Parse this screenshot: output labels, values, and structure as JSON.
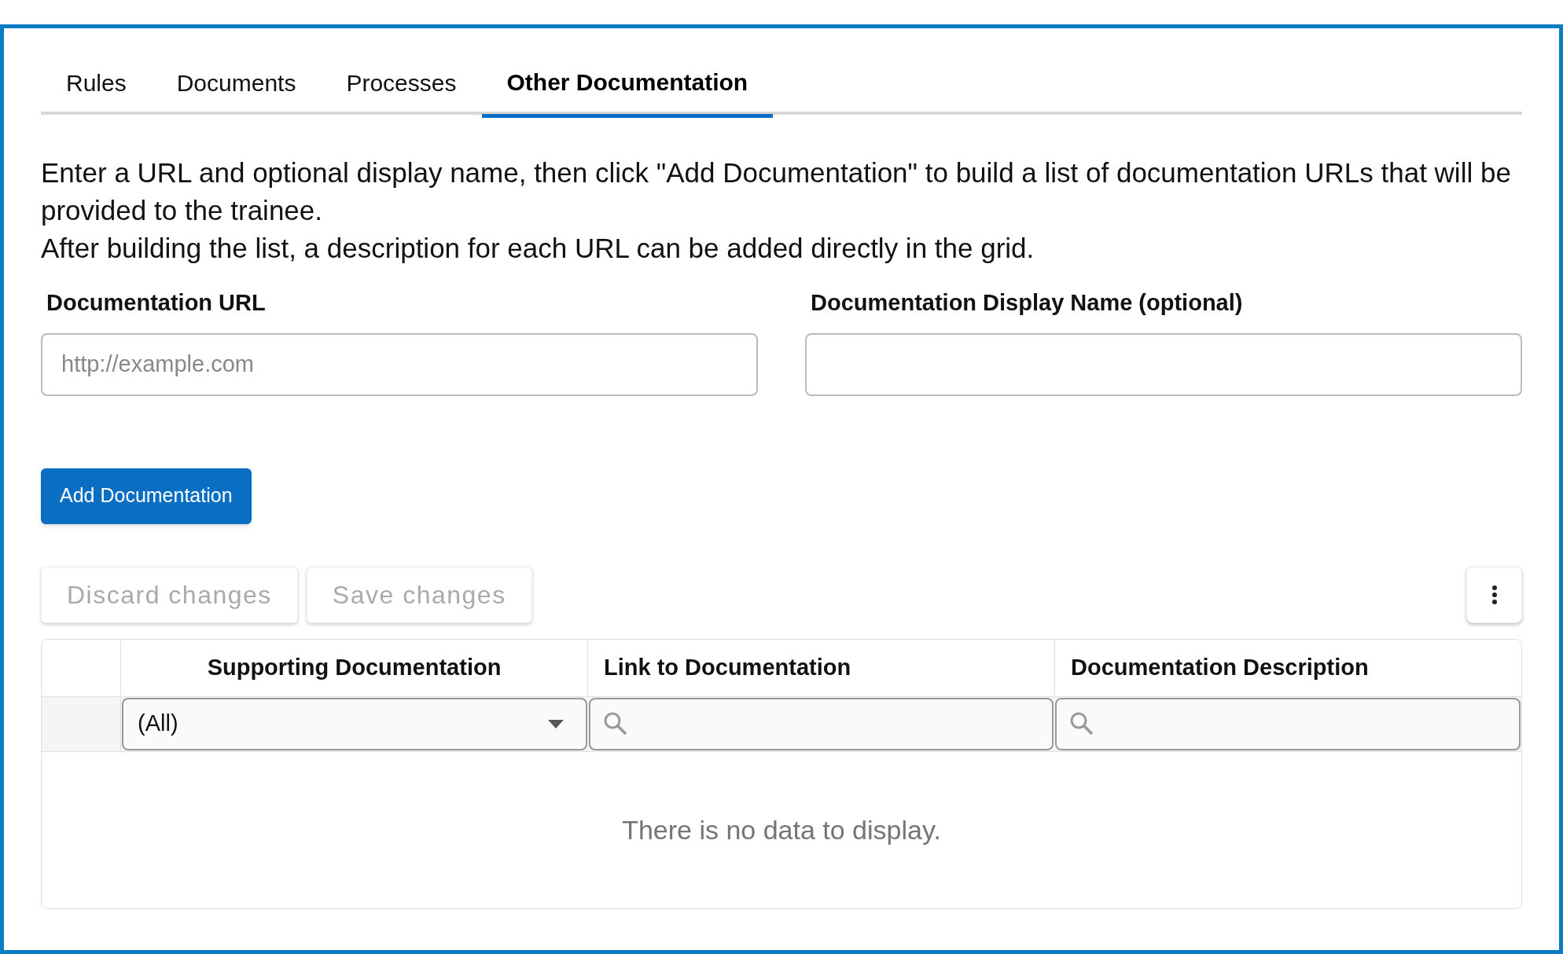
{
  "tabs": [
    {
      "label": "Rules",
      "selected": false
    },
    {
      "label": "Documents",
      "selected": false
    },
    {
      "label": "Processes",
      "selected": false
    },
    {
      "label": "Other Documentation",
      "selected": true
    }
  ],
  "instructions": [
    "Enter a URL and optional display name, then click \"Add Documentation\" to build a list of documentation URLs that will be provided to the trainee.",
    "After building the list, a description for each URL can be added directly in the grid."
  ],
  "fields": [
    {
      "label": "Documentation URL",
      "placeholder": "http://example.com"
    },
    {
      "label": "Documentation Display Name (optional)"
    }
  ],
  "add_button": "Add Documentation",
  "toolbar": {
    "buttons": [
      {
        "label": "Discard changes",
        "disabled": true
      },
      {
        "label": "Save changes",
        "disabled": true
      }
    ]
  },
  "grid": {
    "columns": [
      {
        "title": "Supporting Documentation",
        "filter": {
          "kind": "select",
          "value": "(All)"
        }
      },
      {
        "title": "Link to Documentation",
        "filter": {
          "kind": "search"
        }
      },
      {
        "title": "Documentation Description",
        "filter": {
          "kind": "search"
        }
      }
    ],
    "empty_text": "There is no data to display."
  }
}
